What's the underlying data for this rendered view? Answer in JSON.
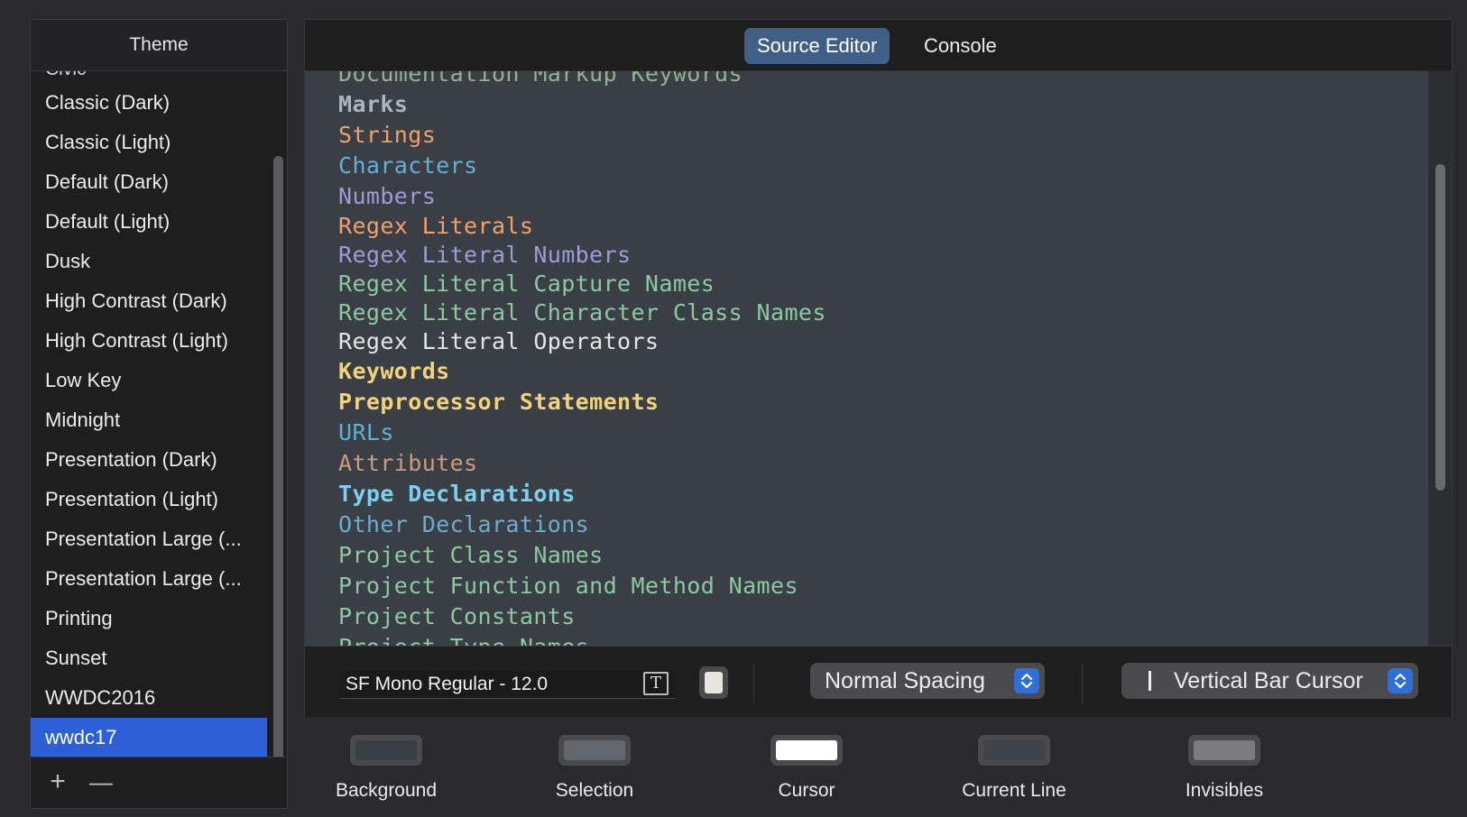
{
  "theme_panel": {
    "header": "Theme",
    "clipped_item": "Civic",
    "items": [
      "Classic (Dark)",
      "Classic (Light)",
      "Default (Dark)",
      "Default (Light)",
      "Dusk",
      "High Contrast (Dark)",
      "High Contrast (Light)",
      "Low Key",
      "Midnight",
      "Presentation (Dark)",
      "Presentation (Light)",
      "Presentation Large (...",
      "Presentation Large (...",
      "Printing",
      "Sunset",
      "WWDC2016",
      "wwdc17"
    ],
    "selected_item": "wwdc17",
    "add_label": "+",
    "remove_label": "—"
  },
  "editor": {
    "tabs": {
      "source_editor": "Source Editor",
      "console": "Console"
    },
    "active_tab": "Source Editor",
    "code_lines": [
      {
        "text": "Documentation Markup Keywords",
        "color": "#8fb38f",
        "bold": false
      },
      {
        "text": "Marks",
        "color": "#aeb4bf",
        "bold": true
      },
      {
        "text": "Strings",
        "color": "#f0a16b",
        "bold": false
      },
      {
        "text": "Characters",
        "color": "#5fb1d8",
        "bold": false
      },
      {
        "text": "Numbers",
        "color": "#a09ad6",
        "bold": false
      },
      {
        "text": "Regex Literals",
        "color": "#f0a16b",
        "bold": false
      },
      {
        "text": "Regex Literal Numbers",
        "color": "#a09ad6",
        "bold": false
      },
      {
        "text": "Regex Literal Capture Names",
        "color": "#8cc9a0",
        "bold": false
      },
      {
        "text": "Regex Literal Character Class Names",
        "color": "#8cc9a0",
        "bold": false
      },
      {
        "text": "Regex Literal Operators",
        "color": "#e6e6e6",
        "bold": false
      },
      {
        "text": "Keywords",
        "color": "#f2d27a",
        "bold": true
      },
      {
        "text": "Preprocessor Statements",
        "color": "#f2d27a",
        "bold": true
      },
      {
        "text": "URLs",
        "color": "#5fb1d8",
        "bold": false
      },
      {
        "text": "Attributes",
        "color": "#cc9b7c",
        "bold": false
      },
      {
        "text": "Type Declarations",
        "color": "#79d2f0",
        "bold": true
      },
      {
        "text": "Other Declarations",
        "color": "#6aaecf",
        "bold": false
      },
      {
        "text": "Project Class Names",
        "color": "#8cc9a0",
        "bold": false
      },
      {
        "text": "Project Function and Method Names",
        "color": "#8cc9a0",
        "bold": false
      },
      {
        "text": "Project Constants",
        "color": "#8cc9a0",
        "bold": false
      },
      {
        "text": "Project Type Names",
        "color": "#8cc9a0",
        "bold": false
      }
    ],
    "font_field": {
      "value": "SF Mono Regular - 12.0",
      "picker_glyph": "T"
    },
    "font_color": "#e8e6dc",
    "spacing_popup": {
      "value": "Normal Spacing"
    },
    "cursor_popup": {
      "value": "Vertical Bar Cursor"
    }
  },
  "color_wells": [
    {
      "label": "Background",
      "color": "#3a3e45"
    },
    {
      "label": "Selection",
      "color": "#63676d"
    },
    {
      "label": "Cursor",
      "color": "#ffffff"
    },
    {
      "label": "Current Line",
      "color": "#3f434a"
    },
    {
      "label": "Invisibles",
      "color": "#7a7c80"
    }
  ],
  "colors": {
    "selection_accent": "#2d5fd7",
    "tab_active": "#3f5f86",
    "popup_arrows": "#2f6fd8"
  }
}
